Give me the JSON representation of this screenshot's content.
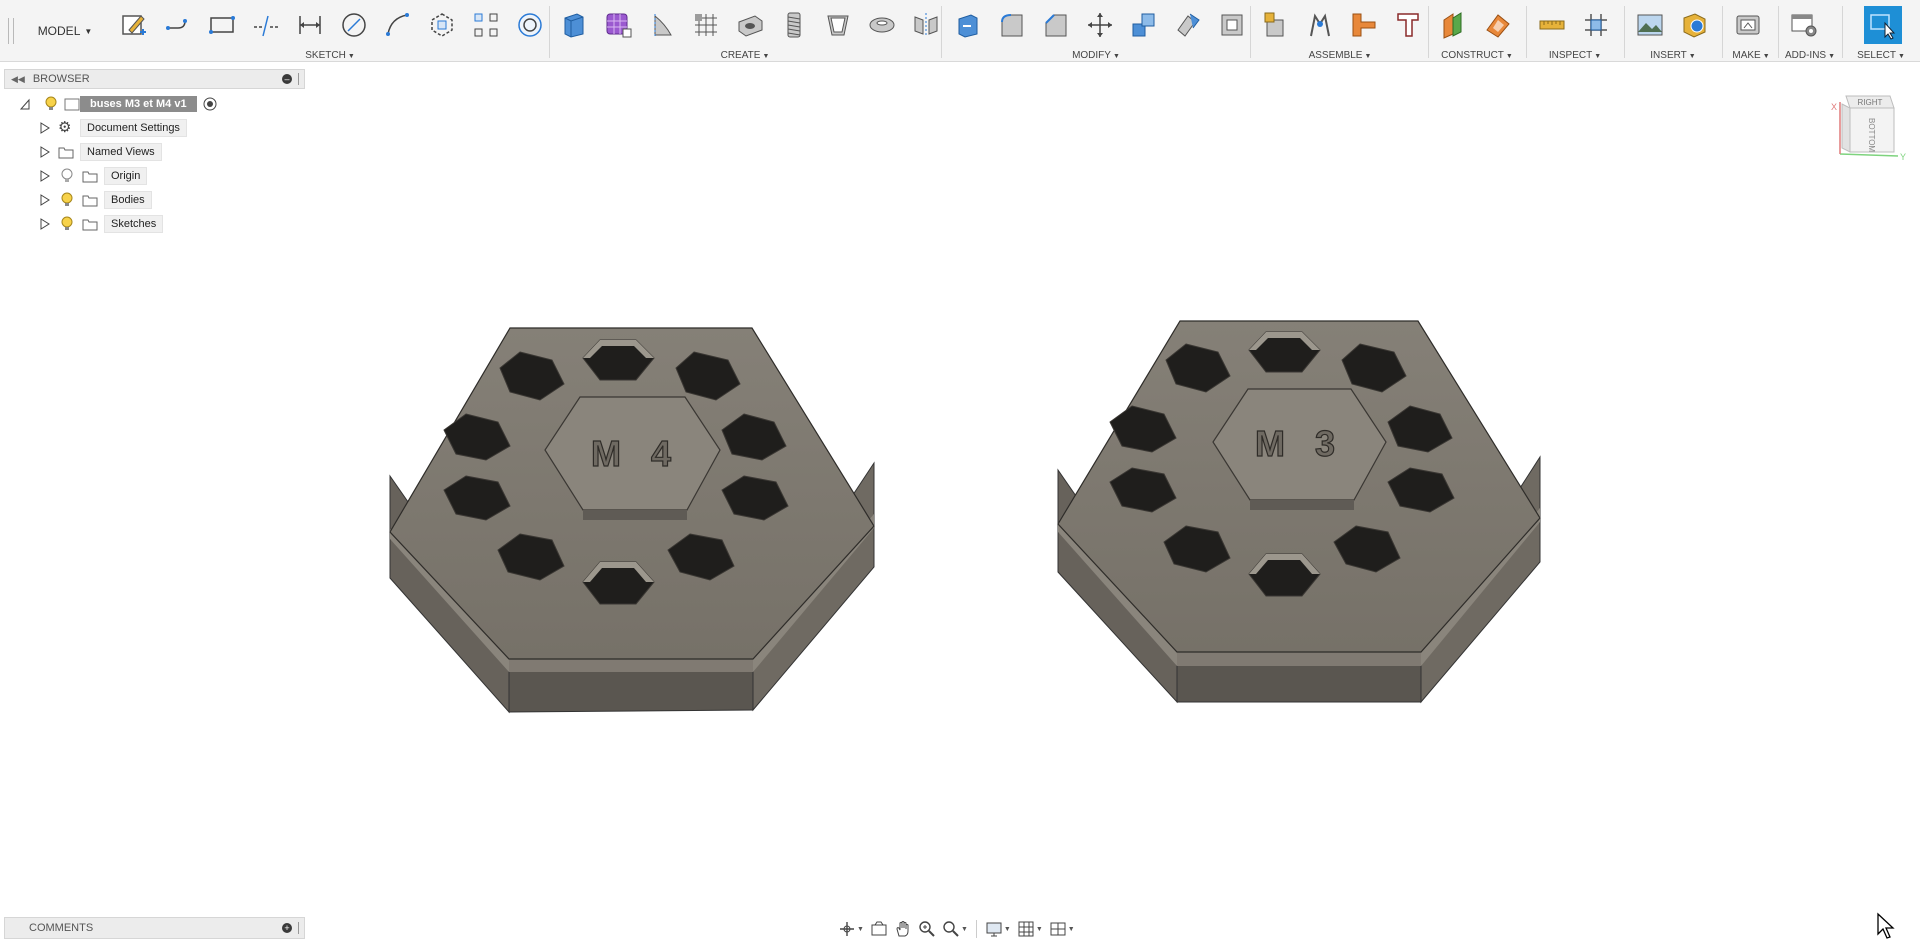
{
  "toolbar": {
    "workspace": "MODEL",
    "groups": {
      "sketch": "SKETCH",
      "create": "CREATE",
      "modify": "MODIFY",
      "assemble": "ASSEMBLE",
      "construct": "CONSTRUCT",
      "inspect": "INSPECT",
      "insert": "INSERT",
      "make": "MAKE",
      "addins": "ADD-INS",
      "select": "SELECT"
    }
  },
  "browser": {
    "title": "BROWSER",
    "root": "buses M3 et M4 v1",
    "items": [
      {
        "label": "Document Settings",
        "icon": "gear-icon"
      },
      {
        "label": "Named Views",
        "icon": "folder-icon"
      },
      {
        "label": "Origin",
        "icon": "folder-icon"
      },
      {
        "label": "Bodies",
        "icon": "folder-icon"
      },
      {
        "label": "Sketches",
        "icon": "folder-icon"
      }
    ]
  },
  "viewport": {
    "models": [
      {
        "label": "M 4"
      },
      {
        "label": "M 3"
      }
    ]
  },
  "viewcube": {
    "top_face": "RIGHT",
    "front_face": "BOTTOM",
    "axis_x": "X",
    "axis_y": "Y"
  },
  "comments": {
    "title": "COMMENTS"
  },
  "colors": {
    "model_face": "#7d776e",
    "model_side": "#5e5a53",
    "accent_blue": "#1e8fd6"
  }
}
